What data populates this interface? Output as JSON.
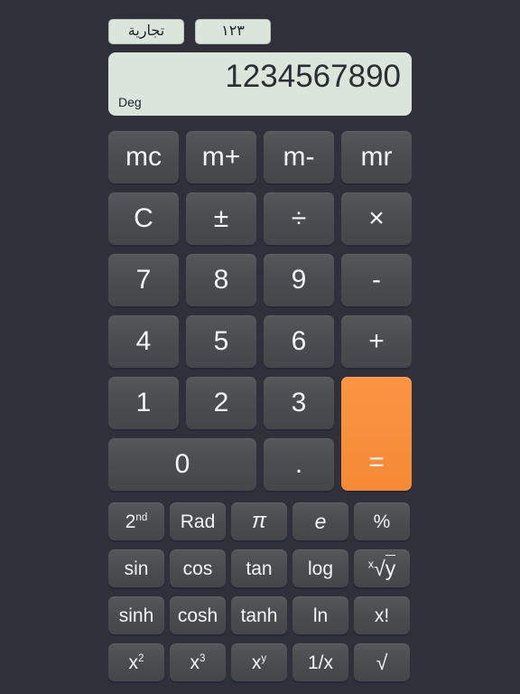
{
  "tabs": [
    {
      "label": "تجارية",
      "name": "tab-commercial"
    },
    {
      "label": "١٢٣",
      "name": "tab-numerals"
    }
  ],
  "display": {
    "value": "1234567890",
    "mode": "Deg"
  },
  "keypad": {
    "rows": [
      [
        {
          "label": "mc",
          "name": "memory-clear-button"
        },
        {
          "label": "m+",
          "name": "memory-add-button"
        },
        {
          "label": "m-",
          "name": "memory-subtract-button"
        },
        {
          "label": "mr",
          "name": "memory-recall-button"
        }
      ],
      [
        {
          "label": "C",
          "name": "clear-button"
        },
        {
          "label": "±",
          "name": "sign-toggle-button"
        },
        {
          "label": "÷",
          "name": "divide-button"
        },
        {
          "label": "×",
          "name": "multiply-button"
        }
      ],
      [
        {
          "label": "7",
          "name": "digit-7-button"
        },
        {
          "label": "8",
          "name": "digit-8-button"
        },
        {
          "label": "9",
          "name": "digit-9-button"
        },
        {
          "label": "-",
          "name": "subtract-button"
        }
      ],
      [
        {
          "label": "4",
          "name": "digit-4-button"
        },
        {
          "label": "5",
          "name": "digit-5-button"
        },
        {
          "label": "6",
          "name": "digit-6-button"
        },
        {
          "label": "+",
          "name": "add-button"
        }
      ],
      [
        {
          "label": "1",
          "name": "digit-1-button"
        },
        {
          "label": "2",
          "name": "digit-2-button"
        },
        {
          "label": "3",
          "name": "digit-3-button"
        },
        {
          "label": "=",
          "name": "equals-button"
        }
      ],
      [
        {
          "label": "0",
          "name": "digit-0-button"
        },
        {
          "label": ".",
          "name": "decimal-point-button"
        }
      ]
    ]
  },
  "scientific": {
    "rows": [
      [
        {
          "label": "2nd",
          "name": "second-function-button"
        },
        {
          "label": "Rad",
          "name": "radians-button"
        },
        {
          "label": "π",
          "name": "pi-button"
        },
        {
          "label": "e",
          "name": "euler-button"
        },
        {
          "label": "%",
          "name": "percent-button"
        }
      ],
      [
        {
          "label": "sin",
          "name": "sine-button"
        },
        {
          "label": "cos",
          "name": "cosine-button"
        },
        {
          "label": "tan",
          "name": "tangent-button"
        },
        {
          "label": "log",
          "name": "log-button"
        },
        {
          "label": "x√y",
          "name": "nth-root-button"
        }
      ],
      [
        {
          "label": "sinh",
          "name": "hyperbolic-sine-button"
        },
        {
          "label": "cosh",
          "name": "hyperbolic-cosine-button"
        },
        {
          "label": "tanh",
          "name": "hyperbolic-tangent-button"
        },
        {
          "label": "ln",
          "name": "natural-log-button"
        },
        {
          "label": "x!",
          "name": "factorial-button"
        }
      ],
      [
        {
          "label": "x²",
          "name": "square-button"
        },
        {
          "label": "x³",
          "name": "cube-button"
        },
        {
          "label": "xʸ",
          "name": "power-button"
        },
        {
          "label": "1/x",
          "name": "reciprocal-button"
        },
        {
          "label": "√",
          "name": "square-root-button"
        }
      ]
    ]
  },
  "colors": {
    "background": "#2f303a",
    "key": "#4b4d51",
    "accent": "#f78f3c",
    "display": "#dce5dc"
  }
}
